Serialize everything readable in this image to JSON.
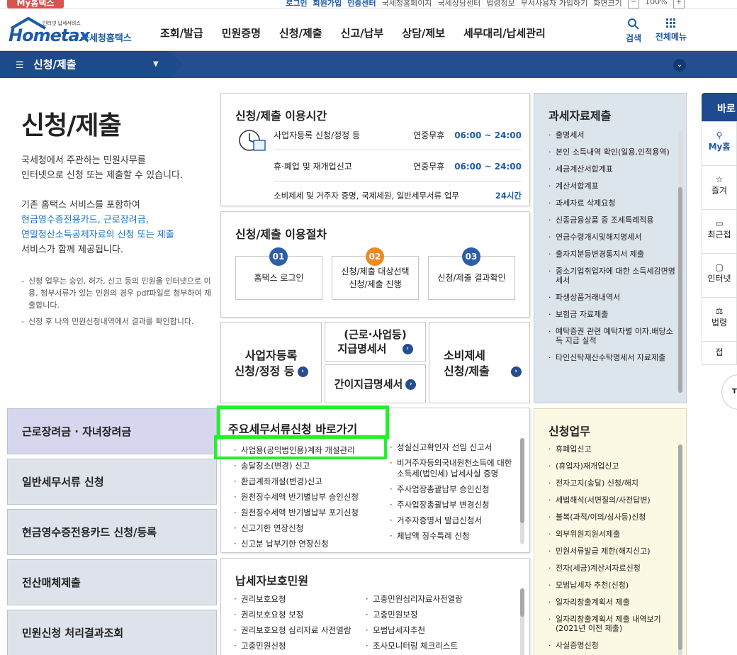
{
  "top": {
    "my_tab": "My홈택스",
    "links": [
      "로그인",
      "회원가입",
      "인증센터",
      "국세청홈페이지",
      "국세상담센터",
      "법령정보",
      "부서사용자 가입하기",
      "화면크기"
    ],
    "zoom": "100%"
  },
  "header": {
    "logo_small": "인터넷 납세서비스",
    "logo_main": "Hometax",
    "logo_sub": "국세청홈택스",
    "gnb": [
      "조회/발급",
      "민원증명",
      "신청/제출",
      "신고/납부",
      "상담/제보",
      "세무대리/납세관리"
    ],
    "search_label": "검색",
    "allmenu_label": "전체메뉴"
  },
  "nav": {
    "current": "신청/제출"
  },
  "page": {
    "title": "신청/제출",
    "desc1": "국세청에서 주관하는 민원사무를",
    "desc2": "인터넷으로 신청 또는 제출할 수 있습니다.",
    "desc3": "기존 홈택스 서비스를 포함하여",
    "desc4": "현금영수증전용카드, 근로장려금,",
    "desc5": "연말정산소득공제자료의 신청 또는 제출",
    "desc6": "서비스가 함께 제공됩니다.",
    "note1": "신청 업무는 승인, 허가, 신고 등의 민원을 인터넷으로 이용, 첨부서류가 있는 민원의 경우 pdf파일로 첨부하여 제출합니다.",
    "note1_bold": "신청 업무",
    "note2": "신청 후 나의 민원신청내역에서 결과를 확인합니다."
  },
  "hours": {
    "title": "신청/제출 이용시간",
    "rows": [
      {
        "label": "사업자등록 신청/정정 등",
        "days": "연중무휴",
        "time": "06:00 ~ 24:00"
      },
      {
        "label": "휴·폐업 및 재개업신고",
        "days": "연중무휴",
        "time": "06:00 ~ 24:00"
      },
      {
        "label": "소비제세 및 거주자 증명, 국제세원, 일반세무서류 업무",
        "days": "",
        "time": "24시간"
      }
    ]
  },
  "procedure": {
    "title": "신청/제출 이용절차",
    "steps": [
      {
        "num": "01",
        "label": "홈택스 로그인"
      },
      {
        "num": "02",
        "label1": "신청/제출 대상선택",
        "label2": "신청/제출 진행"
      },
      {
        "num": "03",
        "label": "신청/제출 결과확인"
      }
    ]
  },
  "quick": {
    "biz1": "사업자등록",
    "biz2": "신청/정정 등",
    "pay1": "(근로·사업등)",
    "pay2": "지급명세서",
    "simple": "간이지급명세서",
    "excise1": "소비제세",
    "excise2": "신청/제출"
  },
  "side_buttons": [
    "근로장려금 · 자녀장려금",
    "일반세무서류 신청",
    "현금영수증전용카드 신청/등록",
    "전산매체제출",
    "민원신청 처리결과조회"
  ],
  "main_docs": {
    "title": "주요세무서류신청 바로가기",
    "left": [
      "사업용(공익법인용)계좌 개설관리",
      "송달장소(변경) 신고",
      "환급계좌개설(변경)신고",
      "원천징수세액 반기별납부 승인신청",
      "원천징수세액 반기별납부 포기신청",
      "신고기한 연장신청",
      "신고분 납부기한 연장신청"
    ],
    "right": [
      "성실신고확인자 선임 신고서",
      "비거주자등의국내원천소득에 대한 소득세(법인세) 납세사실 증명",
      "주사업장총괄납부 승인신청",
      "주사업장총괄납부 변경신청",
      "거주자증명서 발급신청서",
      "체납액 징수특례 신청"
    ]
  },
  "protection": {
    "title": "납세자보호민원",
    "left": [
      "권리보호요청",
      "권리보호요청 보정",
      "권리보호요청 심리자료 사전열람",
      "고충민원신청"
    ],
    "right": [
      "고충민원심리자료사전열람",
      "고충민원보정",
      "모범납세자추천",
      "조사모니터링 체크리스트"
    ]
  },
  "tax_data": {
    "title": "과세자료제출",
    "items": [
      "출명세서",
      "본인 소득내역 확인(일용,인적용역)",
      "세금계산서합계표",
      "계산서합계표",
      "과세자료 삭제요청",
      "신종금융상품 중 조세특례적용",
      "연금수령개시및해지명세서",
      "출자지분등변경통지서 제출",
      "중소기업취업자에 대한 소득세감면명세서",
      "파생상품거래내역서",
      "보험금 자료제출",
      "예탁증권 관련 예탁자별 이자.배당소득 지급 실적",
      "타인신탁재산수탁명세서 자료제출"
    ]
  },
  "apply_work": {
    "title": "신청업무",
    "items": [
      "휴폐업신고",
      "(휴업자)재개업신고",
      "전자고지(송달) 신청/해지",
      "세법해석(서면질의/사전답변)",
      "불복(과적/이의/심사등)신청",
      "외부위원지원서제출",
      "민원서류발급 제한(해지신고)",
      "전자(세금)계산서자료신청",
      "모범납세자 추천(신청)",
      "일자리창출계획서 제출",
      "일자리창출계획서 제출 내역보기(2021년 이전 제출)",
      "사실증명신청"
    ]
  },
  "right_panel": {
    "title": "바로",
    "items": [
      "My홈",
      "즐겨",
      "최근접",
      "인터넷",
      "법령",
      "접"
    ],
    "top": "TO"
  }
}
